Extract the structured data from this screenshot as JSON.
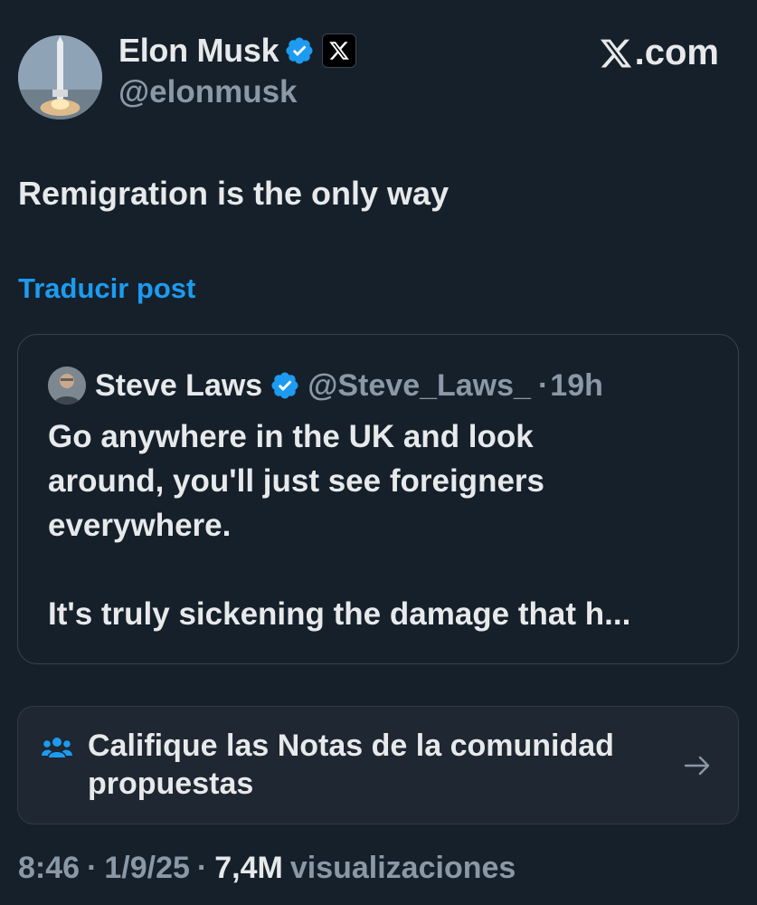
{
  "author": {
    "name": "Elon Musk",
    "handle": "@elonmusk",
    "verified_color": "#1d9bf0",
    "avatar_icon": "rocket-launch-avatar",
    "affiliation_icon": "x-logo-badge"
  },
  "brand": {
    "site_label": ".com",
    "logo_icon": "x-logo"
  },
  "tweet": {
    "text": "Remigration is the only way",
    "translate_label": "Traducir post"
  },
  "quoted": {
    "name": "Steve Laws",
    "handle": "@Steve_Laws_",
    "separator": "·",
    "time": "19h",
    "lines": [
      "Go anywhere in the UK and look",
      "around, you'll just see foreigners",
      "everywhere."
    ],
    "line_last": "It's truly sickening the damage that h..."
  },
  "community_notes": {
    "icon": "people-group-icon",
    "line1": "Califique las Notas de la comunidad",
    "line2": "propuestas",
    "arrow_icon": "arrow-right-icon"
  },
  "meta": {
    "time": "8:46",
    "sep1": "·",
    "date": "1/9/25",
    "sep2": "·",
    "views_count": "7,4M",
    "views_label": "visualizaciones"
  },
  "colors": {
    "background": "#15202b",
    "accent": "#1d9bf0",
    "secondary_text": "#8b98a5"
  }
}
